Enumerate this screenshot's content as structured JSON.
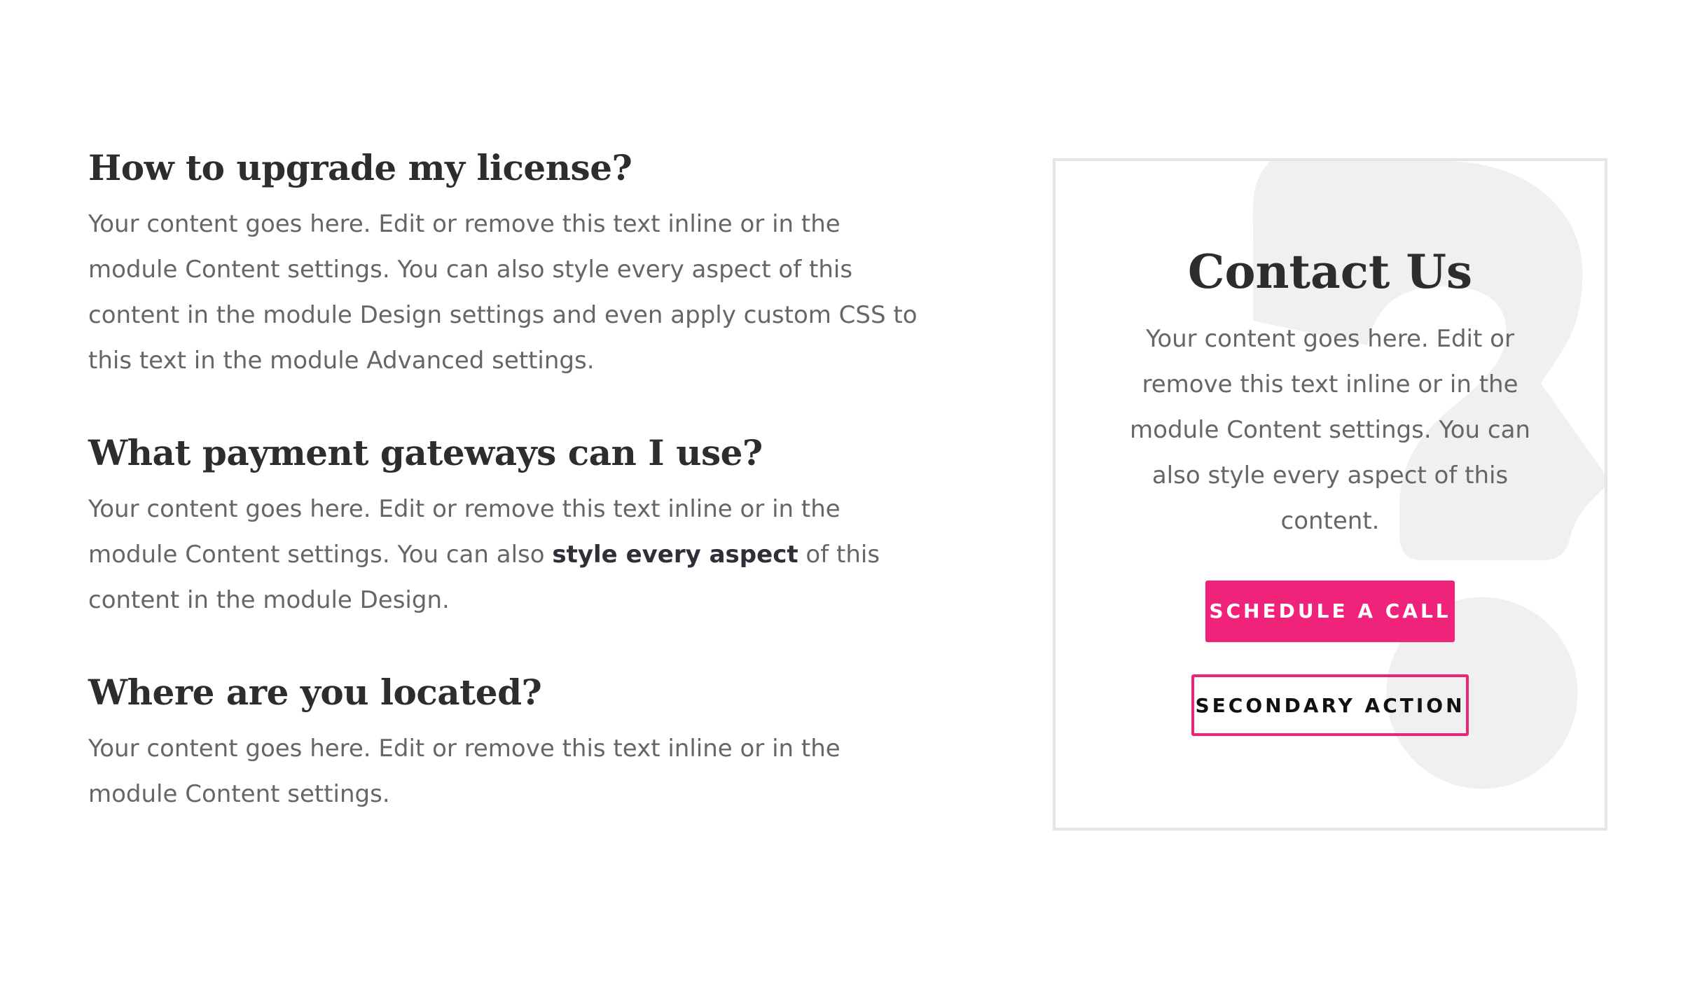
{
  "faq": [
    {
      "question": "How to upgrade my license?",
      "answer": "Your content goes here. Edit or remove this text inline or in the module Content settings. You can also style every aspect of this content in the module Design settings and even apply custom CSS to this text in the module Advanced settings."
    },
    {
      "question": "What payment gateways can I use?",
      "answer_before": "Your content goes here. Edit or remove this text inline or in the module Content settings. You can also ",
      "answer_bold": "style every aspect",
      "answer_after": " of this content in the module Design."
    },
    {
      "question": "Where are you located?",
      "answer": "Your content goes here. Edit or remove this text inline or in the module Content settings."
    }
  ],
  "contact": {
    "title": "Contact Us",
    "text": "Your content goes here. Edit or remove this text inline or in the module Content settings. You can also style every aspect of this content.",
    "primary_button": "Schedule a Call",
    "secondary_button": "Secondary Action",
    "decoration_icon": "question-mark-icon"
  },
  "colors": {
    "accent": "#f0237a",
    "heading": "#2d2d2d",
    "body_text": "#666666",
    "card_border": "#e5e5e5",
    "decoration": "#f0f0f0"
  }
}
